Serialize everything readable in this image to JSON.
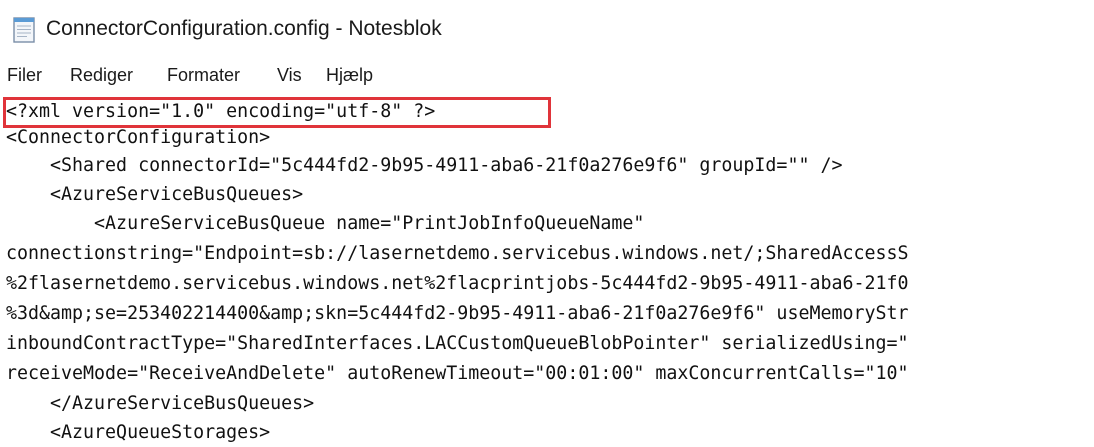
{
  "window": {
    "title": "ConnectorConfiguration.config - Notesblok",
    "icon": "notepad-icon"
  },
  "menu": {
    "items": [
      "Filer",
      "Rediger",
      "Formater",
      "Vis",
      "Hjælp"
    ]
  },
  "editor": {
    "lines": [
      "<?xml version=\"1.0\" encoding=\"utf-8\" ?>",
      "<ConnectorConfiguration>",
      "    <Shared connectorId=\"5c444fd2-9b95-4911-aba6-21f0a276e9f6\" groupId=\"\" />",
      "    <AzureServiceBusQueues>",
      "        <AzureServiceBusQueue name=\"PrintJobInfoQueueName\"",
      "connectionstring=\"Endpoint=sb://lasernetdemo.servicebus.windows.net/;SharedAccessS",
      "%2flasernetdemo.servicebus.windows.net%2flacprintjobs-5c444fd2-9b95-4911-aba6-21f0",
      "%3d&amp;se=253402214400&amp;skn=5c444fd2-9b95-4911-aba6-21f0a276e9f6\" useMemoryStr",
      "inboundContractType=\"SharedInterfaces.LACCustomQueueBlobPointer\" serializedUsing=\"",
      "receiveMode=\"ReceiveAndDelete\" autoRenewTimeout=\"00:01:00\" maxConcurrentCalls=\"10\"",
      "    </AzureServiceBusQueues>",
      "    <AzureQueueStorages>"
    ],
    "highlight_color": "#e0343a"
  }
}
